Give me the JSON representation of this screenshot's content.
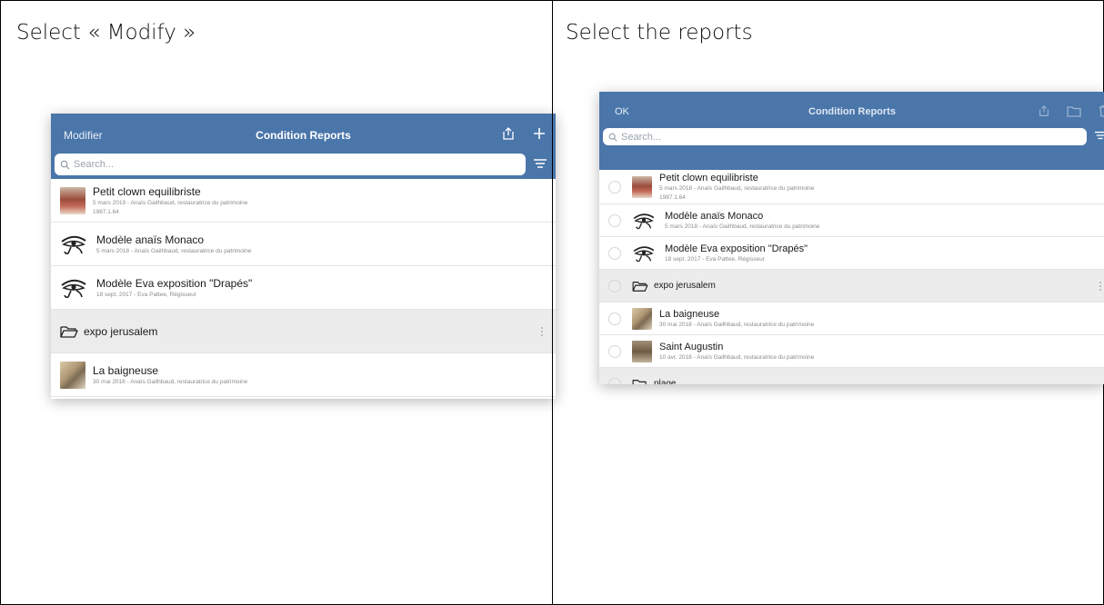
{
  "captions": {
    "left": "Select « Modify »",
    "right": "Select the reports"
  },
  "screen1": {
    "header": {
      "left_button": "Modifier",
      "title": "Condition Reports",
      "icons": [
        "share-icon",
        "plus-icon"
      ]
    },
    "search_placeholder": "Search...",
    "items": [
      {
        "type": "report",
        "thumb": "clown",
        "name": "Petit clown equilibriste",
        "sub1": "5 mars 2019 - Anaïs Gailhbaud, restauratrice du patrimoine",
        "sub2": "1987.1.64"
      },
      {
        "type": "template",
        "name": "Modèle anaïs Monaco",
        "sub1": "5 mars 2018 - Anaïs Gailhbaud, restauratrice du patrimoine"
      },
      {
        "type": "template",
        "name": "Modèle Eva exposition \"Drapés\"",
        "sub1": "18 sept. 2017 - Eva Pattee, Régisseur"
      },
      {
        "type": "folder",
        "name": "expo jerusalem"
      },
      {
        "type": "report",
        "thumb": "baign",
        "name": "La baigneuse",
        "sub1": "30 mai 2018 - Anaïs Gailhbaud, restauratrice du patrimoine"
      }
    ]
  },
  "screen2": {
    "header": {
      "left_button": "OK",
      "title": "Condition Reports",
      "icons": [
        "share-icon",
        "folder-icon",
        "trash-icon"
      ]
    },
    "search_placeholder": "Search...",
    "items": [
      {
        "type": "report",
        "thumb": "clown",
        "name": "Petit clown equilibriste",
        "sub1": "5 mars 2018 - Anaïs Gailhbaud, restauratrice du patrimoine",
        "sub2": "1987.1.64"
      },
      {
        "type": "template",
        "name": "Modèle anaïs Monaco",
        "sub1": "5 mars 2018 - Anaïs Gailhbaud, restauratrice du patrimoine"
      },
      {
        "type": "template",
        "name": "Modèle Eva exposition \"Drapés\"",
        "sub1": "18 sept. 2017 - Eva Pattee, Régisseur"
      },
      {
        "type": "folder",
        "name": "expo jerusalem"
      },
      {
        "type": "report",
        "thumb": "baign",
        "name": "La baigneuse",
        "sub1": "30 mai 2018 - Anaïs Gailhbaud, restauratrice du patrimoine"
      },
      {
        "type": "report",
        "thumb": "aug",
        "name": "Saint Augustin",
        "sub1": "10 avr. 2018 - Anaïs Gailhbaud, restauratrice du patrimoine"
      },
      {
        "type": "folder",
        "name": "plage"
      }
    ]
  },
  "colors": {
    "header_blue": "#4a76aa",
    "folder_row_bg": "#ececec"
  }
}
